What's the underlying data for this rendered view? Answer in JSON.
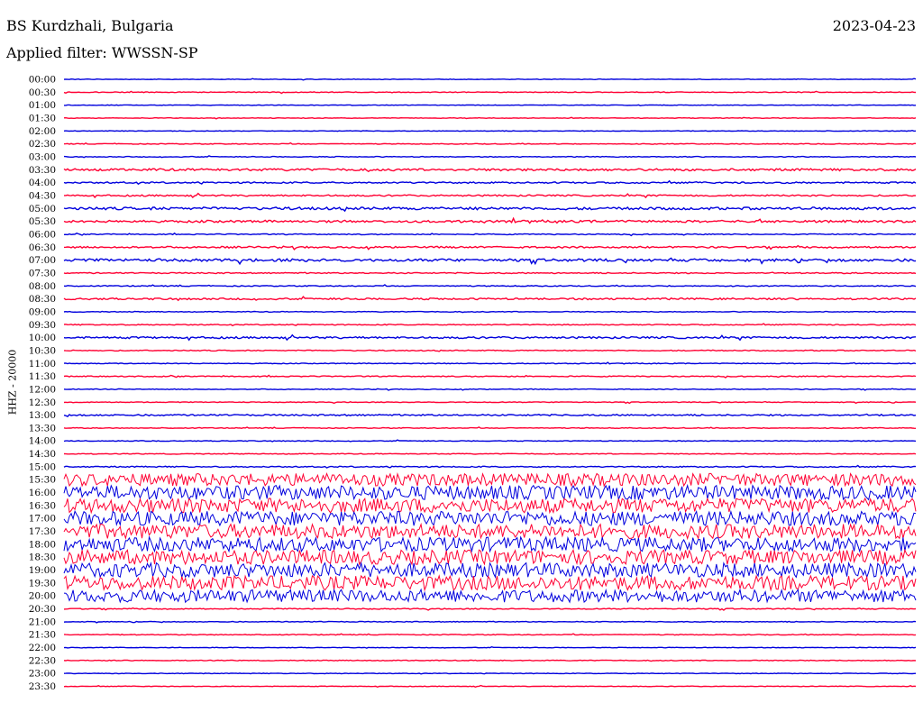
{
  "header": {
    "station": "BS Kurdzhali, Bulgaria",
    "date": "2023-04-23",
    "filter": "Applied filter: WWSSN-SP"
  },
  "colors": {
    "blue": "#0000dd",
    "red": "#ff0033"
  },
  "chart_data": {
    "type": "line",
    "ylabel": "HHZ - 20000",
    "tick_labels": [
      "00:00",
      "00:30",
      "01:00",
      "01:30",
      "02:00",
      "02:30",
      "03:00",
      "03:30",
      "04:00",
      "04:30",
      "05:00",
      "05:30",
      "06:00",
      "06:30",
      "07:00",
      "07:30",
      "08:00",
      "08:30",
      "09:00",
      "09:30",
      "10:00",
      "10:30",
      "11:00",
      "11:30",
      "12:00",
      "12:30",
      "13:00",
      "13:30",
      "14:00",
      "14:30",
      "15:00",
      "15:30",
      "16:00",
      "16:30",
      "17:00",
      "17:30",
      "18:00",
      "18:30",
      "19:00",
      "19:30",
      "20:00",
      "20:30",
      "21:00",
      "21:30",
      "22:00",
      "22:30",
      "23:00",
      "23:30"
    ],
    "trace_colors": [
      "blue",
      "red",
      "blue",
      "red",
      "blue",
      "red",
      "blue",
      "red",
      "blue",
      "red",
      "blue",
      "red",
      "blue",
      "red",
      "blue",
      "red",
      "blue",
      "red",
      "blue",
      "red",
      "blue",
      "red",
      "blue",
      "red",
      "blue",
      "red",
      "blue",
      "red",
      "blue",
      "red",
      "blue",
      "red",
      "blue",
      "red",
      "blue",
      "red",
      "blue",
      "red",
      "blue",
      "red",
      "blue",
      "red",
      "blue",
      "red",
      "blue",
      "red",
      "blue",
      "red"
    ],
    "noise_amplitude": [
      0.3,
      0.4,
      0.3,
      0.3,
      0.3,
      0.4,
      0.4,
      1.2,
      0.8,
      0.8,
      1.4,
      1.2,
      0.5,
      0.9,
      1.4,
      0.6,
      0.5,
      0.9,
      0.4,
      0.5,
      1.0,
      0.5,
      0.4,
      0.5,
      0.4,
      0.4,
      0.8,
      0.4,
      0.4,
      0.4,
      0.6,
      7,
      8,
      8,
      8,
      8,
      8,
      8,
      8,
      8,
      7,
      0.5,
      0.4,
      0.4,
      0.3,
      0.4,
      0.3,
      0.3
    ]
  }
}
